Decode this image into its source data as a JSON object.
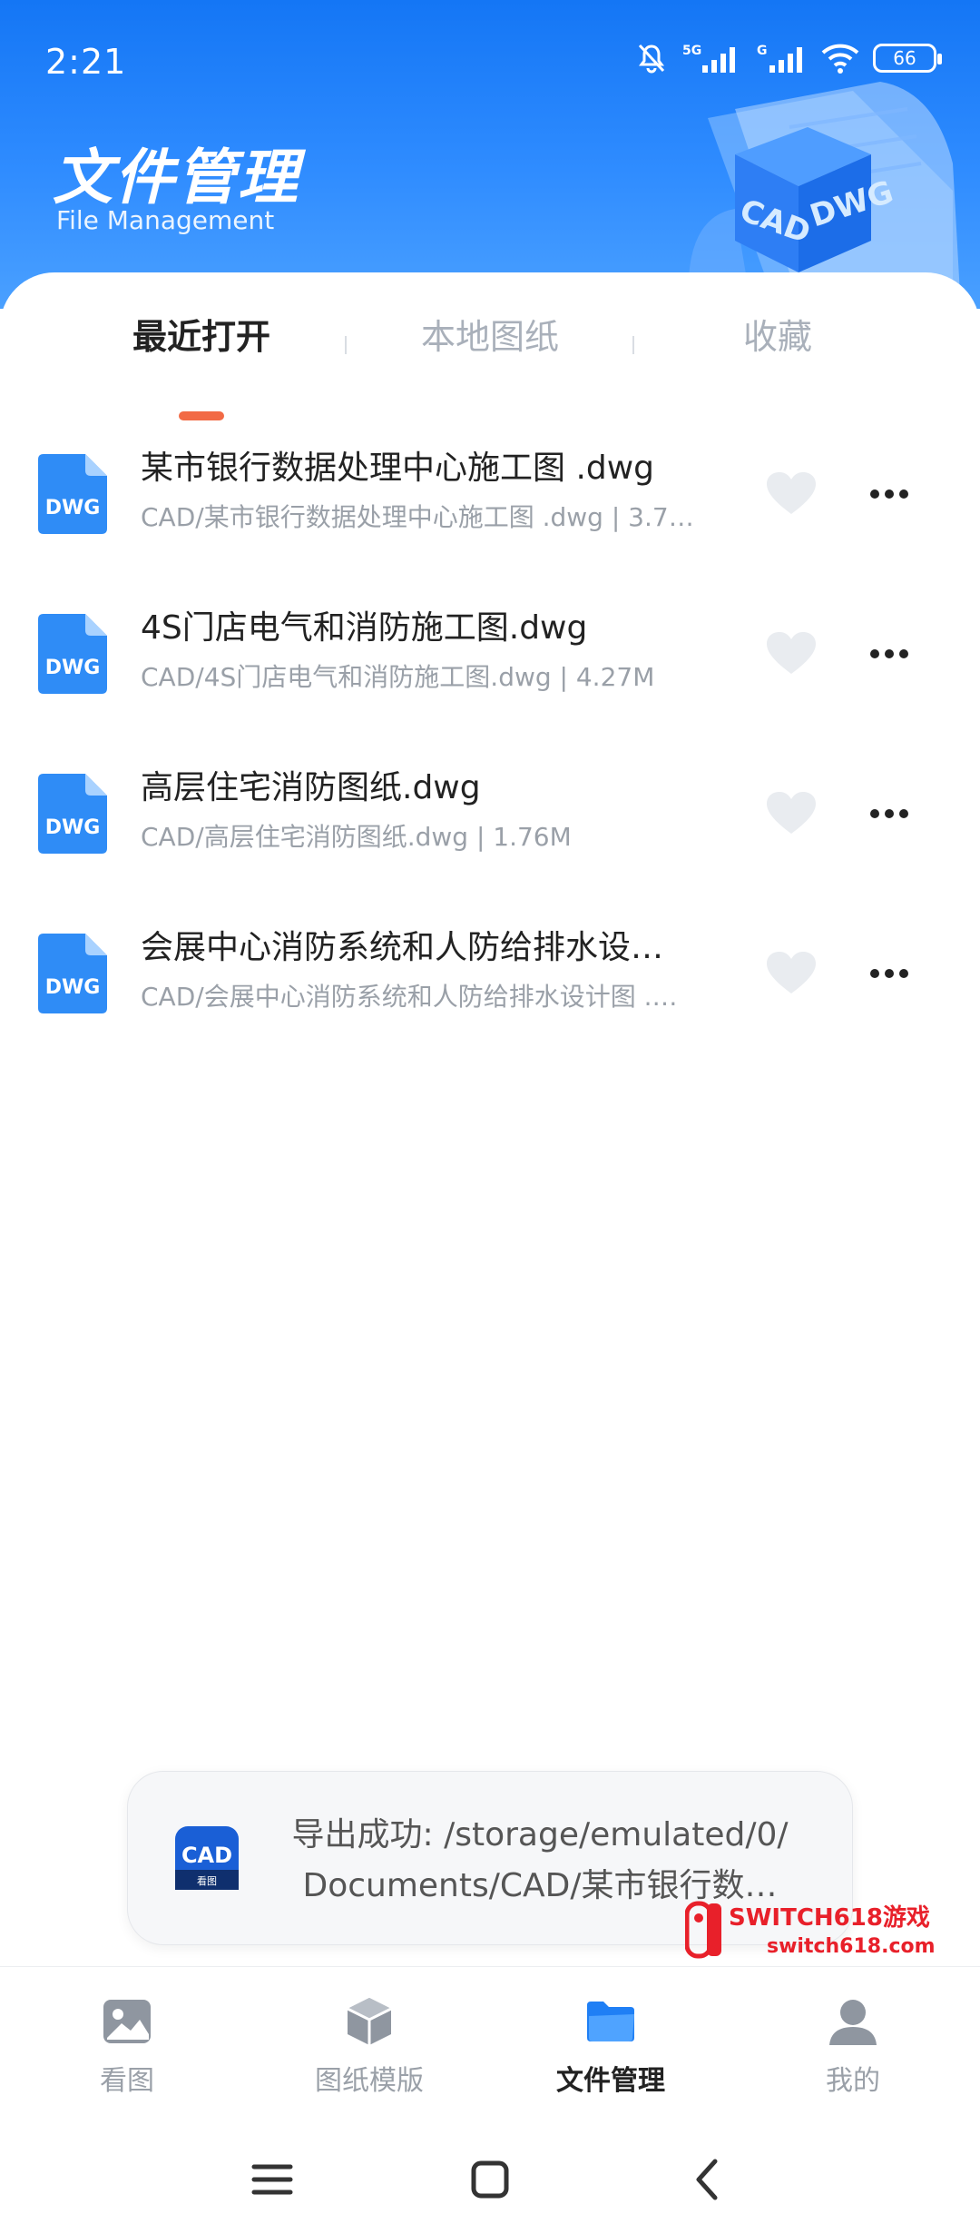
{
  "status_bar": {
    "time": "2:21",
    "network_1": "5G",
    "network_2": "G",
    "battery": "66"
  },
  "header": {
    "title": "文件管理",
    "subtitle": "File Management",
    "art_labels": [
      "CAD",
      "DWG"
    ]
  },
  "tabs": [
    {
      "label": "最近打开",
      "active": true
    },
    {
      "label": "本地图纸",
      "active": false
    },
    {
      "label": "收藏",
      "active": false
    }
  ],
  "files": [
    {
      "icon": "dwg-file-icon",
      "badge": "DWG",
      "name": "某市银行数据处理中心施工图 .dwg",
      "meta": "CAD/某市银行数据处理中心施工图 .dwg | 3.7…"
    },
    {
      "icon": "dwg-file-icon",
      "badge": "DWG",
      "name": "4S门店电气和消防施工图.dwg",
      "meta": "CAD/4S门店电气和消防施工图.dwg | 4.27M"
    },
    {
      "icon": "dwg-file-icon",
      "badge": "DWG",
      "name": "高层住宅消防图纸.dwg",
      "meta": "CAD/高层住宅消防图纸.dwg | 1.76M"
    },
    {
      "icon": "dwg-file-icon",
      "badge": "DWG",
      "name": "会展中心消防系统和人防给排水设…",
      "meta": "CAD/会展中心消防系统和人防给排水设计图 .…"
    }
  ],
  "toast": {
    "line1": "导出成功: /storage/emulated/0/",
    "line2": "Documents/CAD/某市银行数…",
    "app_badge": "CAD",
    "app_badge_sub": "看图"
  },
  "watermark": {
    "line1": "SWITCH618游戏",
    "line2": "switch618.com"
  },
  "bottom_nav": [
    {
      "label": "看图",
      "icon": "image-icon",
      "active": false
    },
    {
      "label": "图纸模版",
      "icon": "cube-icon",
      "active": false
    },
    {
      "label": "文件管理",
      "icon": "folder-icon",
      "active": true
    },
    {
      "label": "我的",
      "icon": "user-icon",
      "active": false
    }
  ],
  "colors": {
    "accent": "#1f7ff5",
    "tab_indicator": "#f26a45",
    "heart": "#e9ecf0",
    "nav_inactive": "#9aa0a8"
  }
}
